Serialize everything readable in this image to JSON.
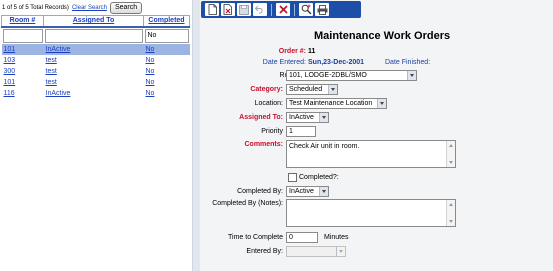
{
  "list": {
    "record_count": "1 of 5 of 5 Total Records)",
    "clear_search": "Clear Search",
    "search_button": "Search",
    "columns": [
      "Room #",
      "Assigned To",
      "Completed"
    ],
    "filter": {
      "room": "",
      "assigned": "",
      "completed": "No"
    },
    "rows": [
      {
        "room": "101",
        "assigned": "InActive",
        "completed": "No"
      },
      {
        "room": "103",
        "assigned": "test",
        "completed": "No"
      },
      {
        "room": "300",
        "assigned": "test",
        "completed": "No"
      },
      {
        "room": "101",
        "assigned": "test",
        "completed": "No"
      },
      {
        "room": "116",
        "assigned": "InActive",
        "completed": "No"
      }
    ]
  },
  "toolbar": {
    "icons": [
      "new-document-icon",
      "copy-document-icon",
      "save-icon",
      "undo-icon",
      "delete-icon",
      "search-icon",
      "print-icon"
    ]
  },
  "form": {
    "title": "Maintenance Work Orders",
    "order_label": "Order #:",
    "order_value": "11",
    "date_entered_label": "Date Entered:",
    "date_entered_value": "Sun,23-Dec-2001",
    "date_finished_label": "Date Finished:",
    "room_label": "Room #:",
    "room_value": "101, LODGE-2DBL/SMO",
    "category_label": "Category:",
    "category_value": "Scheduled",
    "location_label": "Location:",
    "location_value": "Test Maintenance Location",
    "assigned_label": "Assigned To:",
    "assigned_value": "InActive",
    "priority_label": "Priority",
    "priority_value": "1",
    "comments_label": "Comments:",
    "comments_value": "Check Air unit in room.",
    "completed_label": "Completed?:",
    "completed_by_label": "Completed By:",
    "completed_by_value": "InActive",
    "completed_notes_label": "Completed By (Notes):",
    "completed_notes_value": "",
    "time_label": "Time to Complete",
    "time_value": "0",
    "time_unit": "Minutes",
    "entered_by_label": "Entered By:",
    "entered_by_value": ""
  },
  "colors": {
    "toolbar": "#1e4fa6",
    "required_label": "#c8102e",
    "selected_row": "#9cb4e3",
    "link": "#1a3fbf",
    "right_panel_bg": "#f3f4f6"
  }
}
